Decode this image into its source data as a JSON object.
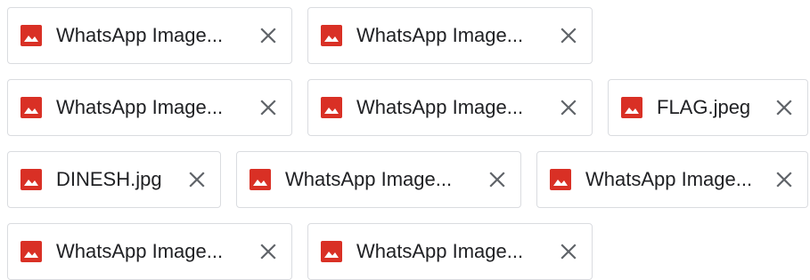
{
  "attachments": {
    "close_tooltip": "Remove attachment",
    "icon": "image-file-icon",
    "icon_color": "#d93025",
    "rows": [
      [
        {
          "name": "WhatsApp Image..."
        },
        {
          "name": "WhatsApp Image..."
        }
      ],
      [
        {
          "name": "WhatsApp Image..."
        },
        {
          "name": "WhatsApp Image..."
        },
        {
          "name": "FLAG.jpeg"
        }
      ],
      [
        {
          "name": "DINESH.jpg"
        },
        {
          "name": "WhatsApp Image..."
        },
        {
          "name": "WhatsApp Image..."
        }
      ],
      [
        {
          "name": "WhatsApp Image..."
        },
        {
          "name": "WhatsApp Image..."
        }
      ]
    ]
  }
}
